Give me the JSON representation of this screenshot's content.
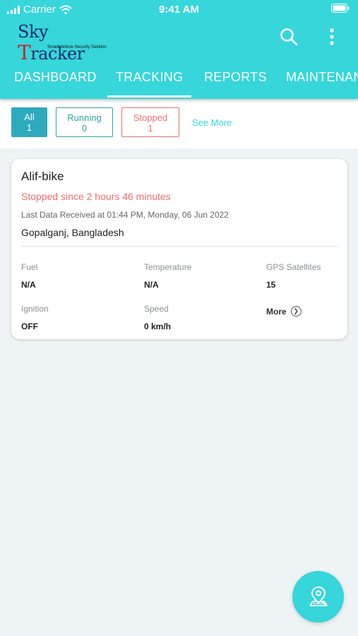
{
  "status_bar": {
    "carrier": "Carrier",
    "time": "9:41 AM"
  },
  "app": {
    "logo_brand_left": "Sky ",
    "logo_brand_r": "T",
    "logo_brand_right": "racker",
    "logo_tagline": "Smart Vehicle Security Solution"
  },
  "tabs": [
    {
      "label": "DASHBOARD"
    },
    {
      "label": "TRACKING"
    },
    {
      "label": "REPORTS"
    },
    {
      "label": "MAINTENAN"
    }
  ],
  "filters": {
    "all": {
      "label": "All",
      "count": "1"
    },
    "running": {
      "label": "Running",
      "count": "0"
    },
    "stopped": {
      "label": "Stopped",
      "count": "1"
    },
    "see_more": "See More"
  },
  "vehicle": {
    "name": "Alif-bike",
    "status_text": "Stopped since 2 hours 46 minutes",
    "last_data": "Last Data Received at 01:44 PM, Monday, 06 Jun 2022",
    "location": "Gopalganj, Bangladesh",
    "fields": {
      "fuel_label": "Fuel",
      "fuel_value": "N/A",
      "temperature_label": "Temperature",
      "temperature_value": "N/A",
      "gps_label": "GPS Satellites",
      "gps_value": "15",
      "ignition_label": "Ignition",
      "ignition_value": "OFF",
      "speed_label": "Speed",
      "speed_value": "0 km/h"
    },
    "more_label": "More"
  },
  "colors": {
    "primary": "#36d6da",
    "running": "#2ea59d",
    "stopped": "#e7716f"
  }
}
